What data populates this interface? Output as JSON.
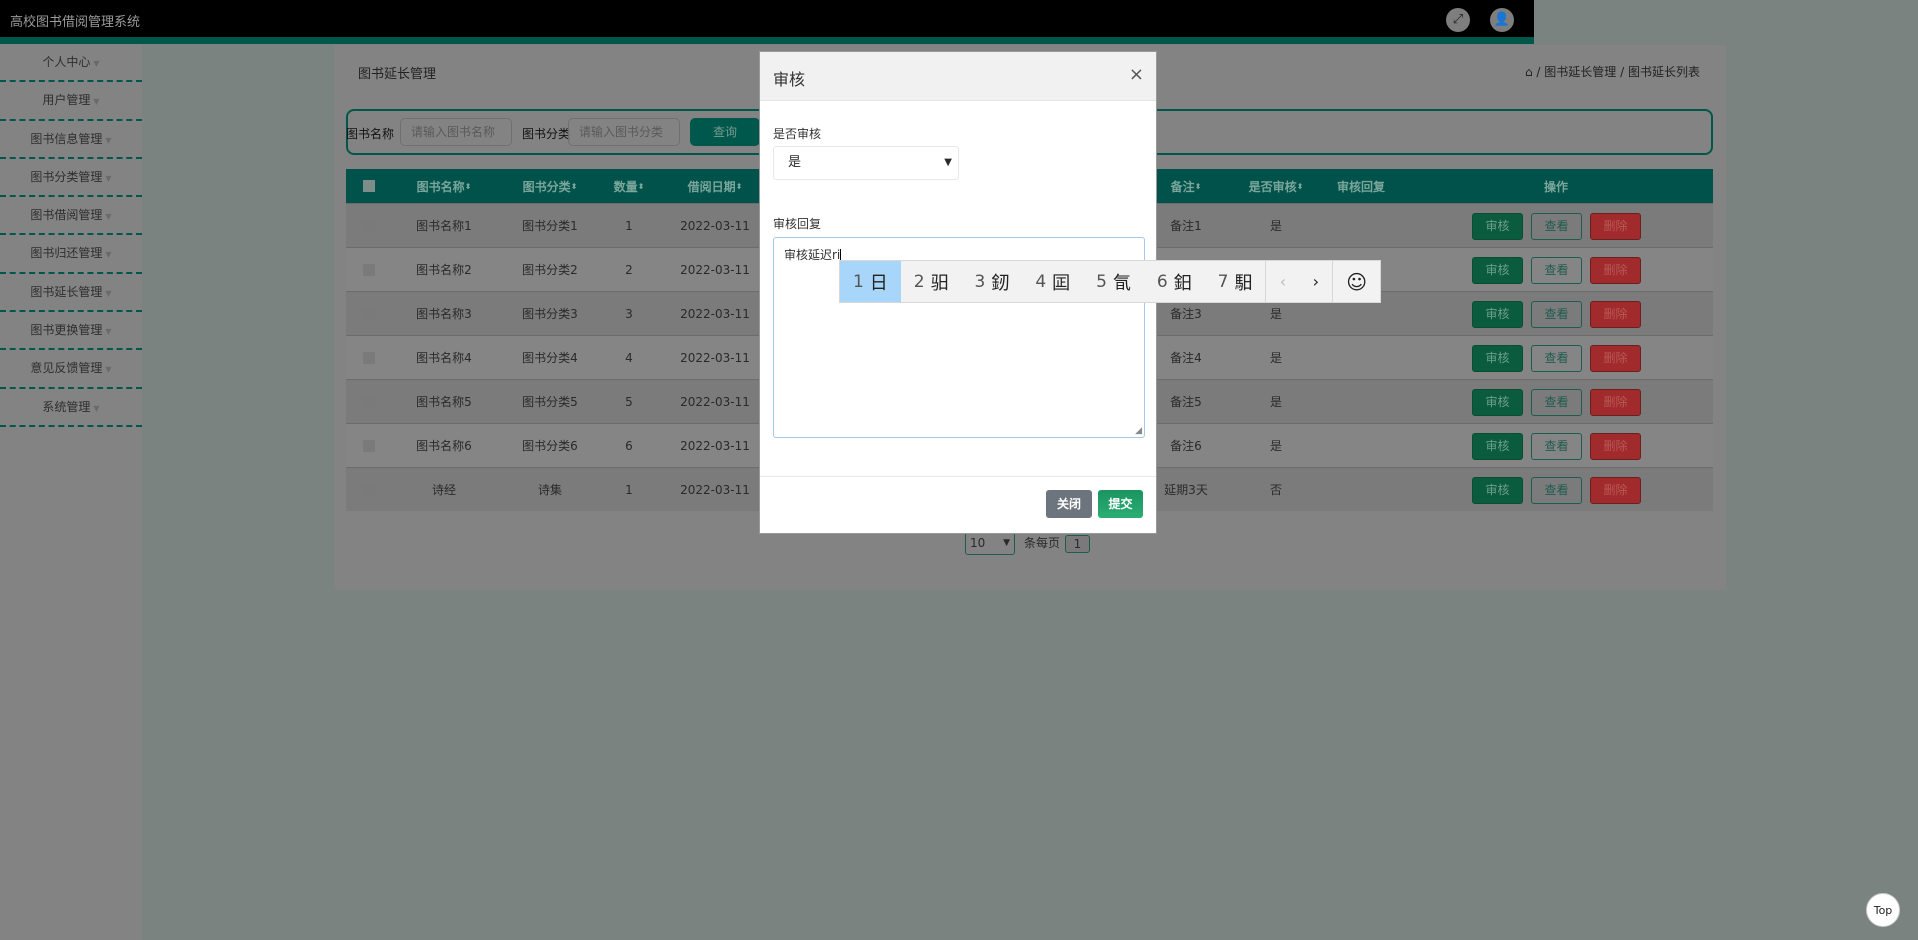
{
  "app_title": "高校图书借阅管理系统",
  "header_icons": [
    "fullscreen-icon",
    "user-icon"
  ],
  "sidebar": {
    "items": [
      {
        "label": "个人中心"
      },
      {
        "label": "用户管理"
      },
      {
        "label": "图书信息管理"
      },
      {
        "label": "图书分类管理"
      },
      {
        "label": "图书借阅管理"
      },
      {
        "label": "图书归还管理"
      },
      {
        "label": "图书延长管理"
      },
      {
        "label": "图书更换管理"
      },
      {
        "label": "意见反馈管理"
      },
      {
        "label": "系统管理"
      }
    ]
  },
  "page": {
    "title": "图书延长管理",
    "breadcrumb": [
      "图书延长管理",
      "图书延长列表"
    ],
    "breadcrumb_sep": "/"
  },
  "search": {
    "name_label": "图书名称",
    "name_placeholder": "请输入图书名称",
    "cat_label": "图书分类",
    "cat_placeholder": "请输入图书分类",
    "query_label": "查询"
  },
  "table": {
    "headers": {
      "name": "图书名称",
      "category": "图书分类",
      "qty": "数量",
      "date": "借阅日期",
      "remark": "备注",
      "approved": "是否审核",
      "reply": "审核回复",
      "actions": "操作"
    },
    "rows": [
      {
        "name": "图书名称1",
        "category": "图书分类1",
        "qty": "1",
        "date": "2022-03-11",
        "remark": "备注1",
        "approved": "是"
      },
      {
        "name": "图书名称2",
        "category": "图书分类2",
        "qty": "2",
        "date": "2022-03-11",
        "remark": "",
        "approved": ""
      },
      {
        "name": "图书名称3",
        "category": "图书分类3",
        "qty": "3",
        "date": "2022-03-11",
        "remark": "备注3",
        "approved": "是"
      },
      {
        "name": "图书名称4",
        "category": "图书分类4",
        "qty": "4",
        "date": "2022-03-11",
        "remark": "备注4",
        "approved": "是"
      },
      {
        "name": "图书名称5",
        "category": "图书分类5",
        "qty": "5",
        "date": "2022-03-11",
        "remark": "备注5",
        "approved": "是"
      },
      {
        "name": "图书名称6",
        "category": "图书分类6",
        "qty": "6",
        "date": "2022-03-11",
        "remark": "备注6",
        "approved": "是"
      },
      {
        "name": "诗经",
        "category": "诗集",
        "qty": "1",
        "date": "2022-03-11",
        "remark": "延期3天",
        "approved": "否"
      }
    ],
    "action_labels": {
      "review": "审核",
      "view": "查看",
      "delete": "删除"
    }
  },
  "pagination": {
    "page_size": "10",
    "per_page_label": "条每页",
    "current_page": "1"
  },
  "modal": {
    "title": "审核",
    "close": "×",
    "approve_label": "是否审核",
    "approve_value": "是",
    "reply_label": "审核回复",
    "reply_value": "审核延迟ri",
    "cancel_label": "关闭",
    "submit_label": "提交"
  },
  "ime": {
    "candidates": [
      {
        "n": "1",
        "c": "日"
      },
      {
        "n": "2",
        "c": "驲"
      },
      {
        "n": "3",
        "c": "釰"
      },
      {
        "n": "4",
        "c": "囸"
      },
      {
        "n": "5",
        "c": "氜"
      },
      {
        "n": "6",
        "c": "鈤"
      },
      {
        "n": "7",
        "c": "馹"
      }
    ],
    "prev": "‹",
    "next": "›",
    "emoji": "☺"
  },
  "back_to_top": "Top",
  "colors": {
    "teal": "#00574b",
    "review": "#0b5c3e",
    "delete": "#a02a2c",
    "submit": "#1e9e6a",
    "close": "#6c757d",
    "ime_selected": "#a8d6fa"
  }
}
